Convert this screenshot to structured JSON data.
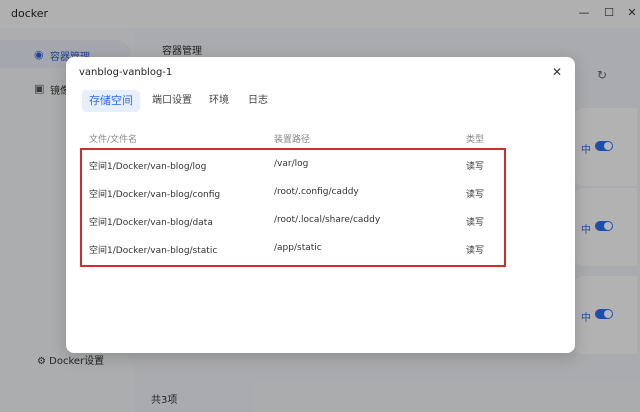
{
  "window": {
    "title": "docker",
    "controls": [
      "—",
      "☐",
      "✕"
    ]
  },
  "sidebar": {
    "items": [
      {
        "label": "容器管理",
        "icon": "container-icon",
        "glyph": "◉",
        "active": true
      },
      {
        "label": "镜像",
        "icon": "image-icon",
        "glyph": "▣",
        "active": false
      }
    ],
    "footer": {
      "label": "Docker设置",
      "icon": "settings-icon",
      "glyph": "⚙"
    }
  },
  "main": {
    "title": "容器管理",
    "refresh_glyph": "↻",
    "cards": [
      {
        "status": "中"
      },
      {
        "status": "中"
      },
      {
        "status": "中"
      }
    ],
    "footer": "共3项"
  },
  "dialog": {
    "title": "vanblog-vanblog-1",
    "close_glyph": "✕",
    "tabs": [
      {
        "label": "存储空间",
        "active": true
      },
      {
        "label": "端口设置",
        "active": false
      },
      {
        "label": "环境",
        "active": false
      },
      {
        "label": "日志",
        "active": false
      }
    ],
    "columns": [
      "文件/文件名",
      "装置路径",
      "类型"
    ],
    "rows": [
      {
        "file": "空间1/Docker/van-blog/log",
        "mount": "/var/log",
        "type": "读写"
      },
      {
        "file": "空间1/Docker/van-blog/config",
        "mount": "/root/.config/caddy",
        "type": "读写"
      },
      {
        "file": "空间1/Docker/van-blog/data",
        "mount": "/root/.local/share/caddy",
        "type": "读写"
      },
      {
        "file": "空间1/Docker/van-blog/static",
        "mount": "/app/static",
        "type": "读写"
      }
    ],
    "highlight_color": "#d42b2b",
    "accent_color": "#2a6df4"
  }
}
